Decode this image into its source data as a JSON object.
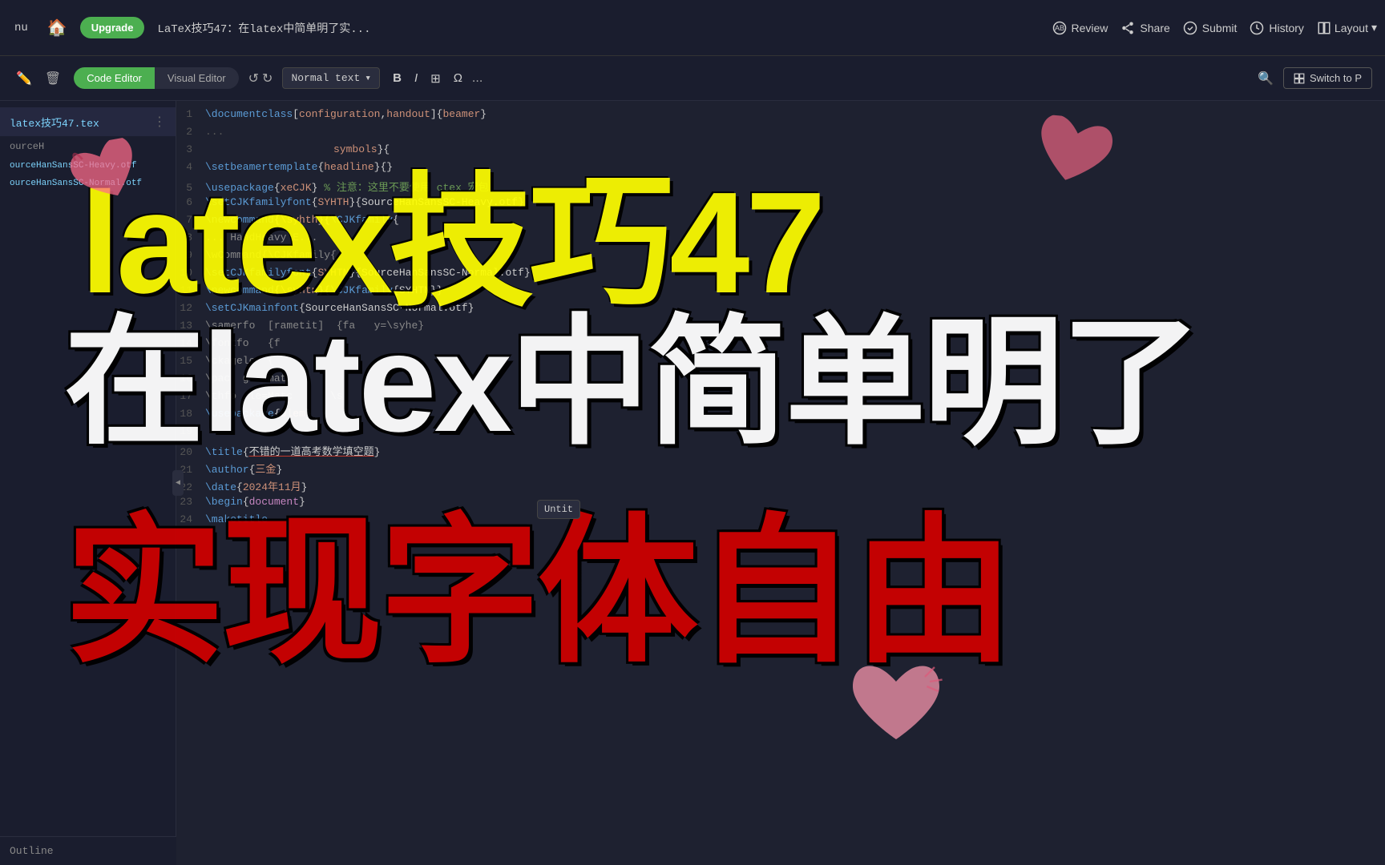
{
  "topNav": {
    "menu_label": "nu",
    "upgrade_label": "Upgrade",
    "doc_title": "LaTeX技巧47：在latex中简单明了实...",
    "review_label": "Review",
    "share_label": "Share",
    "submit_label": "Submit",
    "history_label": "History",
    "layout_label": "Layout"
  },
  "toolbar": {
    "code_editor_label": "Code Editor",
    "visual_editor_label": "Visual Editor",
    "normal_text_label": "Normal text",
    "bold_label": "B",
    "italic_label": "I",
    "more_label": "...",
    "switch_to_label": "Switch to P"
  },
  "sidebar": {
    "file_name": "latex技巧47.tex",
    "folder_items": [
      "ourceH",
      "ourceHanSansSC-Heavy.otf",
      "ourceHanSansSC-Normal.otf"
    ]
  },
  "codeLines": [
    {
      "num": "1",
      "content": "\\documentclass[configuration,handout]{beamer}"
    },
    {
      "num": "2",
      "content": "..."
    },
    {
      "num": "3",
      "content": "                 symbols}{"
    },
    {
      "num": "4",
      "content": "\\setbeamertemplate{headline}{}"
    },
    {
      "num": "5",
      "content": "\\usepackage{xeCJK} % 注意：这里不要使用 ctex 宏包"
    },
    {
      "num": "6",
      "content": "\\setCJKfamilyfont{SYHTH}{SourceHanSansSC-Heavy.otf}"
    },
    {
      "num": "7",
      "content": "\\newcommand{\\syhth}{\\CJKfamily{"
    },
    {
      "num": "8",
      "content": "...HandHeavy E..."
    },
    {
      "num": "9",
      "content": "\\wCommand{\\CJKfamily{"
    },
    {
      "num": "10",
      "content": "\\setCJKfamilyfont{SYHTN}{SourceHanSansSC-Normal.otf}"
    },
    {
      "num": "11",
      "content": "\\newcommand{\\syhtn}{\\CJKfamily{SYHTN}}"
    },
    {
      "num": "12",
      "content": "\\setCJKmainfont{SourceHanSansSC-Normal.otf}"
    },
    {
      "num": "13",
      "content": "\\samerfo  [rametit]  {fa   y=\\syhe}"
    },
    {
      "num": "14",
      "content": "\\fontfo   {f"
    },
    {
      "num": "15",
      "content": "\\ckagelo  {"
    },
    {
      "num": "16",
      "content": "\\pac  g   mat"
    },
    {
      "num": "17",
      "content": "\\thfo  le=Matc      \\s"
    },
    {
      "num": "18",
      "content": "\\usepackage{ulem}"
    },
    {
      "num": "19",
      "content": ""
    },
    {
      "num": "20",
      "content": "\\title{不错的一道高考数学填空题}"
    },
    {
      "num": "21",
      "content": "\\author{三金}"
    },
    {
      "num": "22",
      "content": "\\date{2024年11月}"
    },
    {
      "num": "23",
      "content": "\\begin{document}"
    },
    {
      "num": "24",
      "content": "\\maketitle"
    }
  ],
  "overlay": {
    "text1": "latex技巧47",
    "text2": "在latex中简单明了",
    "text3": "实现字体自由"
  },
  "outline": {
    "label": "Outline"
  },
  "tooltip": {
    "text": "Untit"
  }
}
